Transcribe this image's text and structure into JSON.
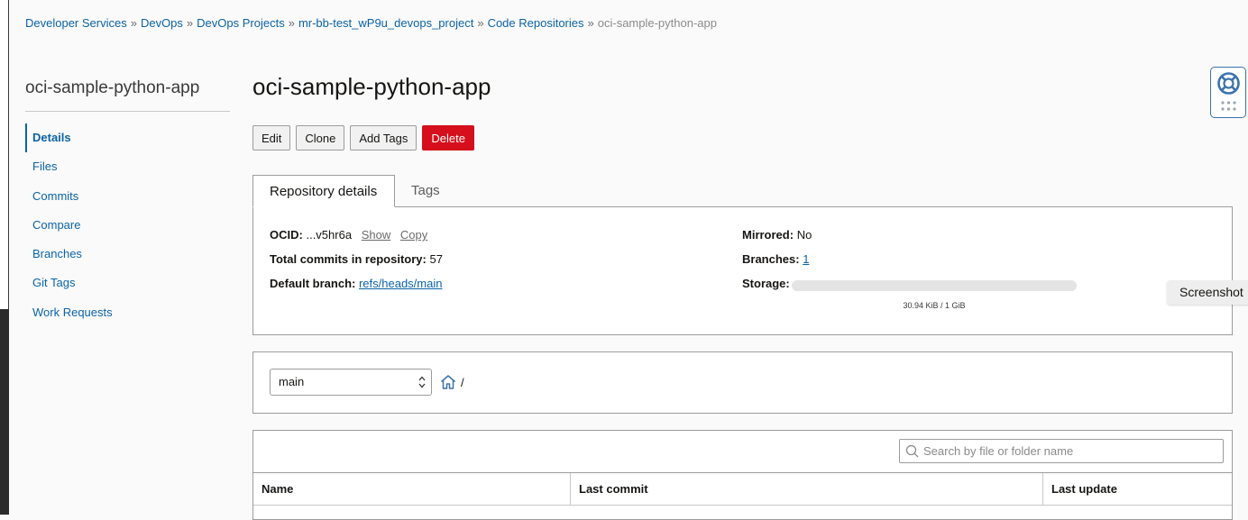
{
  "breadcrumb": {
    "items": [
      "Developer Services",
      "DevOps",
      "DevOps Projects",
      "mr-bb-test_wP9u_devops_project",
      "Code Repositories"
    ],
    "separator": "»",
    "current": "oci-sample-python-app"
  },
  "sidebar": {
    "title": "oci-sample-python-app",
    "items": [
      {
        "label": "Details",
        "active": true
      },
      {
        "label": "Files",
        "active": false
      },
      {
        "label": "Commits",
        "active": false
      },
      {
        "label": "Compare",
        "active": false
      },
      {
        "label": "Branches",
        "active": false
      },
      {
        "label": "Git Tags",
        "active": false
      },
      {
        "label": "Work Requests",
        "active": false
      }
    ]
  },
  "page": {
    "title": "oci-sample-python-app"
  },
  "actions": {
    "edit": "Edit",
    "clone": "Clone",
    "add_tags": "Add Tags",
    "delete": "Delete"
  },
  "tabs": {
    "repository_details": "Repository details",
    "tags": "Tags"
  },
  "details": {
    "ocid_label": "OCID:",
    "ocid_value": "...v5hr6a",
    "show": "Show",
    "copy": "Copy",
    "total_commits_label": "Total commits in repository:",
    "total_commits_value": "57",
    "default_branch_label": "Default branch:",
    "default_branch_value": "refs/heads/main",
    "mirrored_label": "Mirrored:",
    "mirrored_value": "No",
    "branches_label": "Branches:",
    "branches_value": "1",
    "storage_label": "Storage:",
    "storage_text": "30.94 KiB / 1 GiB",
    "storage_fraction": 3e-05
  },
  "branch_selector": {
    "selected": "main",
    "path": "/"
  },
  "files": {
    "search_placeholder": "Search by file or folder name",
    "columns": [
      "Name",
      "Last commit",
      "Last update"
    ]
  },
  "overlay": {
    "screenshot_label": "Screenshot"
  },
  "colors": {
    "link": "#0b63a8",
    "danger": "#d50f1c",
    "accent": "#3b73ad"
  }
}
